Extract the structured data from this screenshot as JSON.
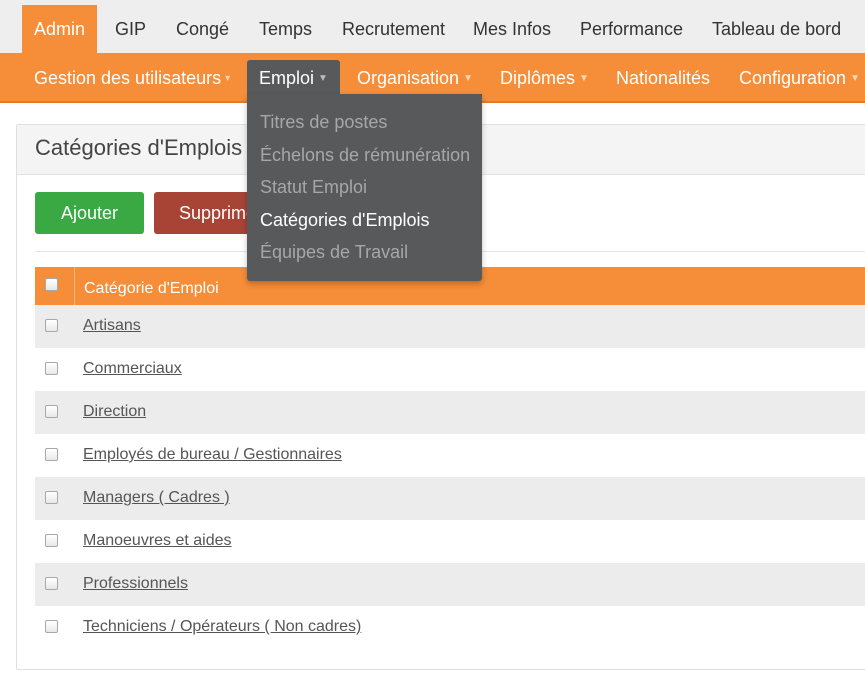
{
  "topnav": {
    "items": [
      {
        "label": "Admin",
        "active": true
      },
      {
        "label": "GIP"
      },
      {
        "label": "Congé"
      },
      {
        "label": "Temps"
      },
      {
        "label": "Recrutement"
      },
      {
        "label": "Mes Infos"
      },
      {
        "label": "Performance"
      },
      {
        "label": "Tableau de bord"
      }
    ]
  },
  "subnav": {
    "items": [
      {
        "label": "Gestion des utilisateurs",
        "caret": "▾"
      },
      {
        "label": "Emploi",
        "caret": "▼",
        "active": true
      },
      {
        "label": "Organisation",
        "caret": "▼"
      },
      {
        "label": "Diplômes",
        "caret": "▼"
      },
      {
        "label": "Nationalités"
      },
      {
        "label": "Configuration",
        "caret": "▼"
      }
    ]
  },
  "dropdown": {
    "items": [
      {
        "label": "Titres de postes"
      },
      {
        "label": "Échelons de rémunération"
      },
      {
        "label": "Statut Emploi"
      },
      {
        "label": "Catégories d'Emplois",
        "active": true
      },
      {
        "label": "Équipes de Travail"
      }
    ]
  },
  "panel": {
    "title": "Catégories d'Emplois"
  },
  "actions": {
    "add_label": "Ajouter",
    "delete_label": "Supprimer"
  },
  "table": {
    "header": "Catégorie d'Emploi",
    "rows": [
      "Artisans",
      "Commerciaux",
      "Direction",
      "Employés de bureau / Gestionnaires",
      "Managers ( Cadres )",
      "Manoeuvres et aides",
      "Professionnels",
      "Techniciens / Opérateurs ( Non cadres)"
    ]
  },
  "colors": {
    "accent": "#f68d38",
    "menu_dark": "#58595b",
    "add_green": "#3aa843",
    "delete_red": "#a74435"
  }
}
